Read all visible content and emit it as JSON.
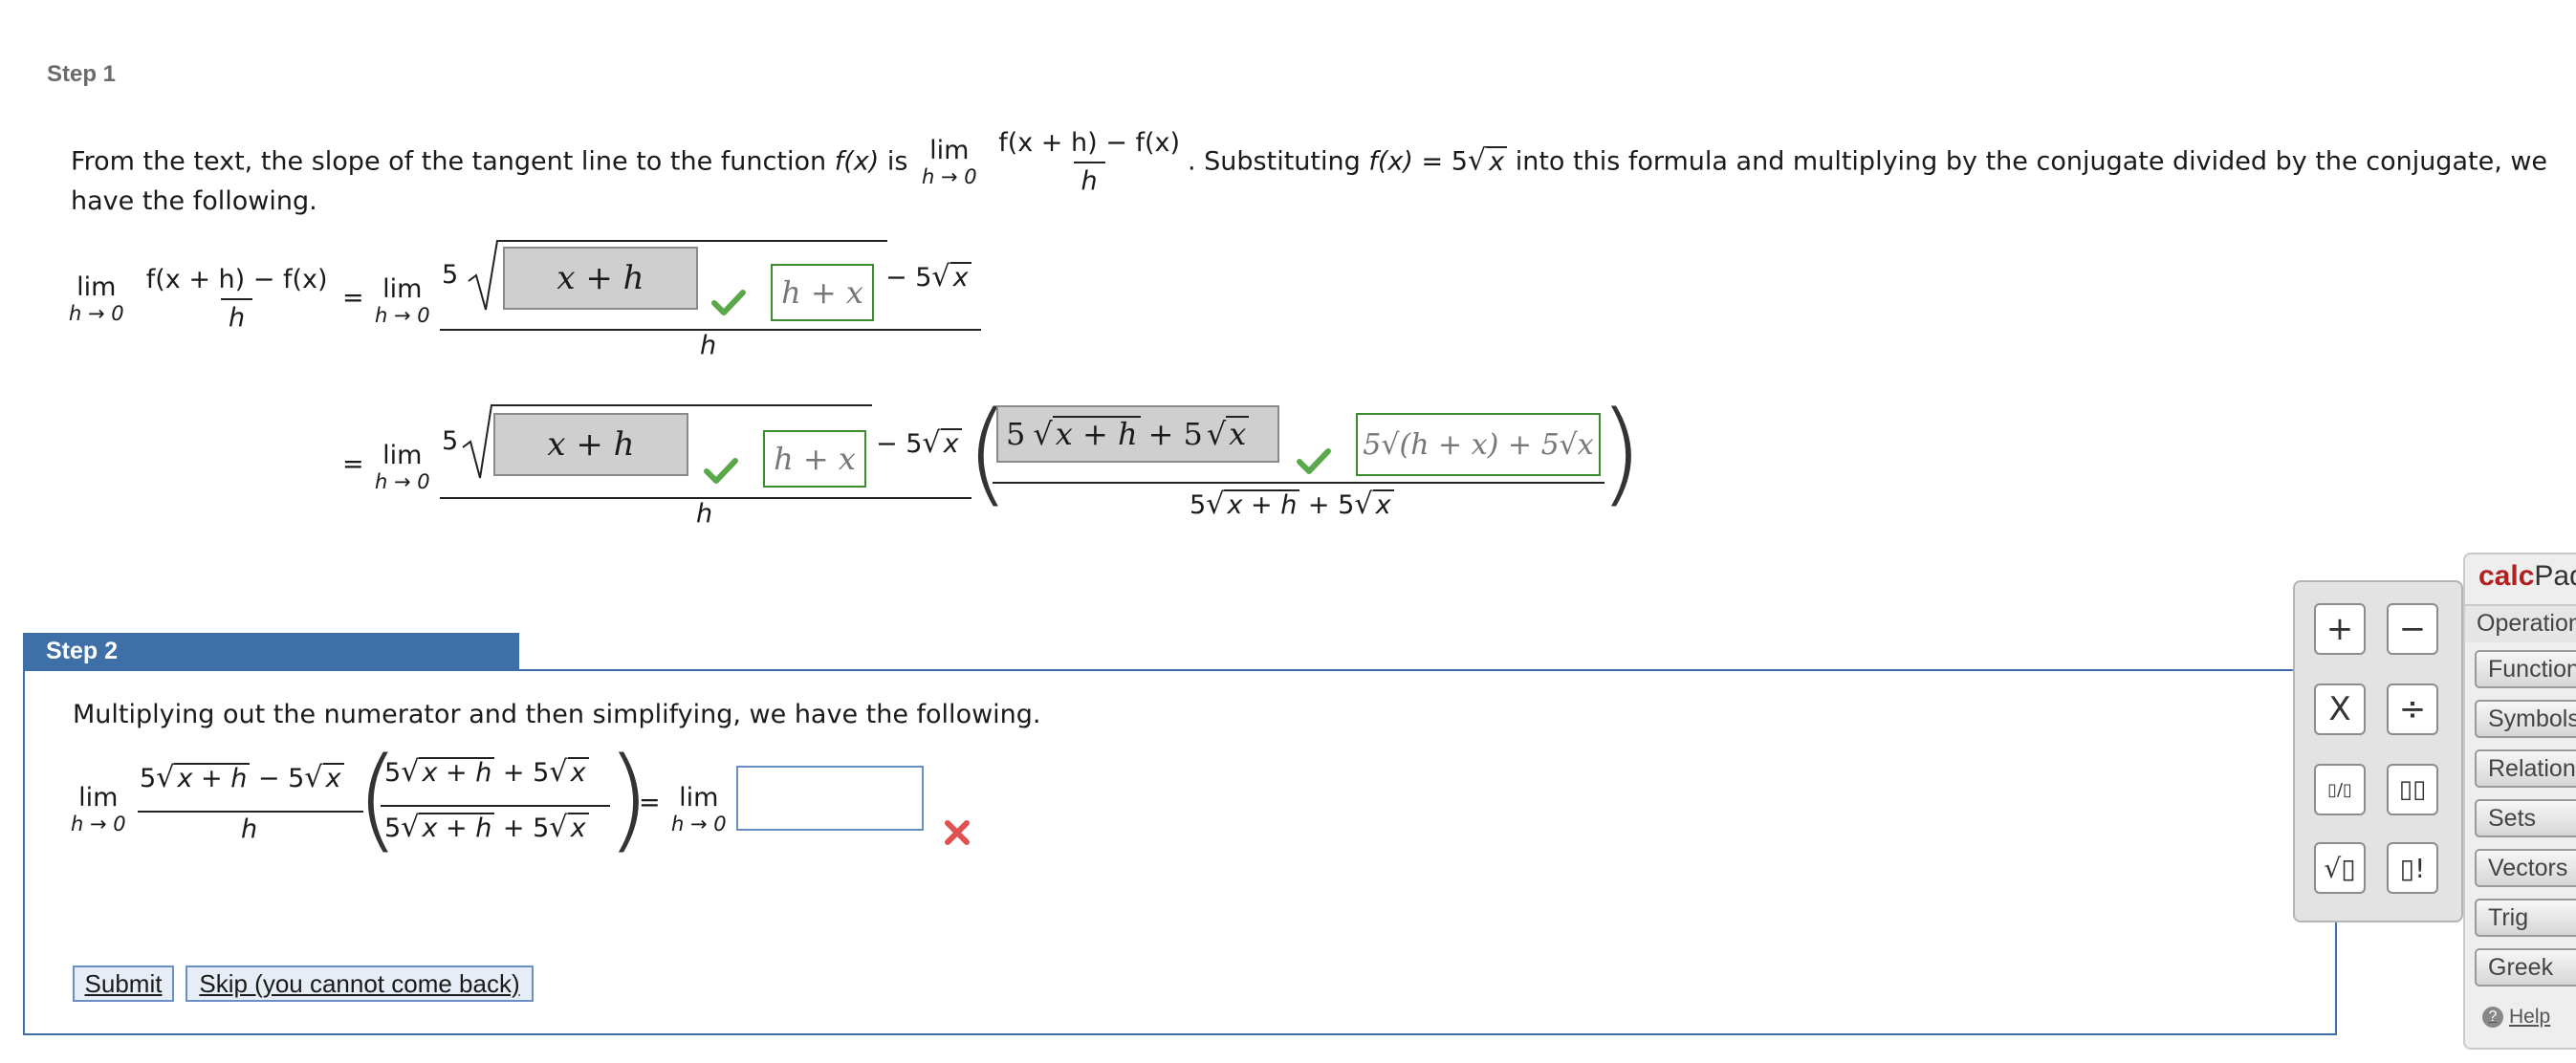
{
  "step1": {
    "label": "Step 1",
    "intro_part1": "From the text, the slope of the tangent line to the function ",
    "f_of_x": "f(x)",
    "intro_is": " is ",
    "lim": "lim",
    "h_to_0": "h → 0",
    "diff_quotient_num": "f(x + h) − f(x)",
    "h": "h",
    "intro_part2": ". Substituting ",
    "f_def_lhs": "f(x)",
    "eq": " = 5",
    "sqrt_x": "x",
    "intro_part3": " into this formula and multiplying by the conjugate divided by the conjugate, we",
    "intro_line2": "have the following.",
    "eq1": {
      "equals": "=",
      "coef": "5",
      "answer_box": "x + h",
      "answer_entry": "h + x",
      "minus_term": "− 5",
      "sqrt_x": "x"
    },
    "eq2": {
      "equals": "=",
      "coef": "5",
      "answer_box": "x + h",
      "answer_entry": "h + x",
      "minus_term": "− 5",
      "sqrt_x": "x",
      "conj_box_5a": "5",
      "conj_box_expr": "x + h",
      "conj_box_plus5": "+ 5",
      "conj_box_x": "x",
      "conj_entry": "5√(h + x) + 5√x",
      "den_5a": "5",
      "den_xh": "x + h",
      "den_plus5": " + 5",
      "den_x": "x"
    }
  },
  "step2": {
    "label": "Step 2",
    "instruction": "Multiplying out the numerator and then simplifying, we have the following.",
    "num_5a": "5",
    "num_xh": "x + h",
    "num_minus5": " − 5",
    "num_x": "x",
    "den_h": "h",
    "conj_num_5": "5",
    "conj_num_xh": "x + h",
    "conj_num_plus5": " + 5",
    "conj_num_x": "x",
    "equals": "=",
    "answer_value": "",
    "submit_label": "Submit",
    "skip_label": "Skip (you cannot come back)"
  },
  "keypad": {
    "keys": [
      "+",
      "−",
      "X",
      "÷",
      "▯/▯",
      "▯▯",
      "√▯",
      "▯!"
    ]
  },
  "calcpad": {
    "title_a": "calc",
    "title_b": "Pad",
    "categories": [
      "Operations",
      "Functions",
      "Symbols",
      "Relations",
      "Sets",
      "Vectors",
      "Trig",
      "Greek"
    ],
    "help": "Help"
  },
  "colors": {
    "step_tab": "#3f6fa7",
    "check_green": "#5aa84a",
    "cross_red": "#e05252",
    "calc_brand": "#b32020"
  }
}
